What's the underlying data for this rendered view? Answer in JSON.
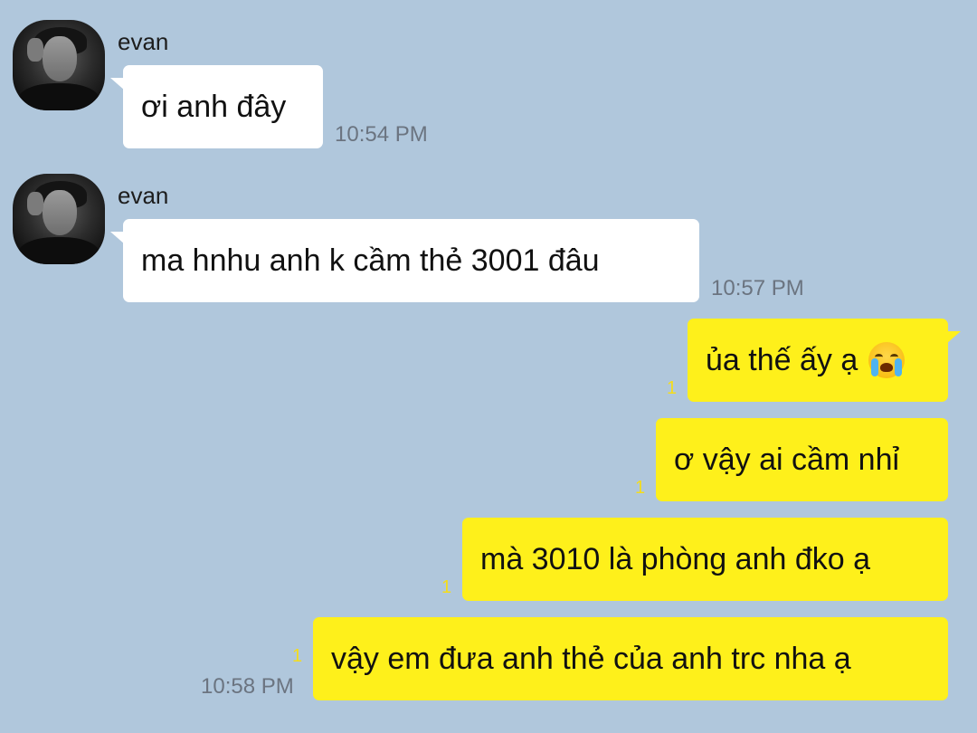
{
  "chat": {
    "messages": [
      {
        "sender": "evan",
        "text": "ơi anh đây",
        "time": "10:54 PM"
      },
      {
        "sender": "evan",
        "text": "ma hnhu anh k cầm thẻ 3001 đâu",
        "time": "10:57 PM"
      },
      {
        "text": "ủa thế ấy ạ",
        "emoji": "loudly-crying-face-icon",
        "unread": "1"
      },
      {
        "text": "ơ vậy ai cầm nhỉ",
        "unread": "1"
      },
      {
        "text": "mà 3010 là phòng anh đko ạ",
        "unread": "1"
      },
      {
        "text": "vậy em đưa anh thẻ của anh trc nha ạ",
        "unread": "1",
        "time": "10:58 PM"
      }
    ]
  },
  "colors": {
    "background": "#b0c7dc",
    "incoming_bubble": "#ffffff",
    "outgoing_bubble": "#fef01b",
    "unread_counter": "#f5dd1a",
    "timestamp": "#6b7480"
  }
}
